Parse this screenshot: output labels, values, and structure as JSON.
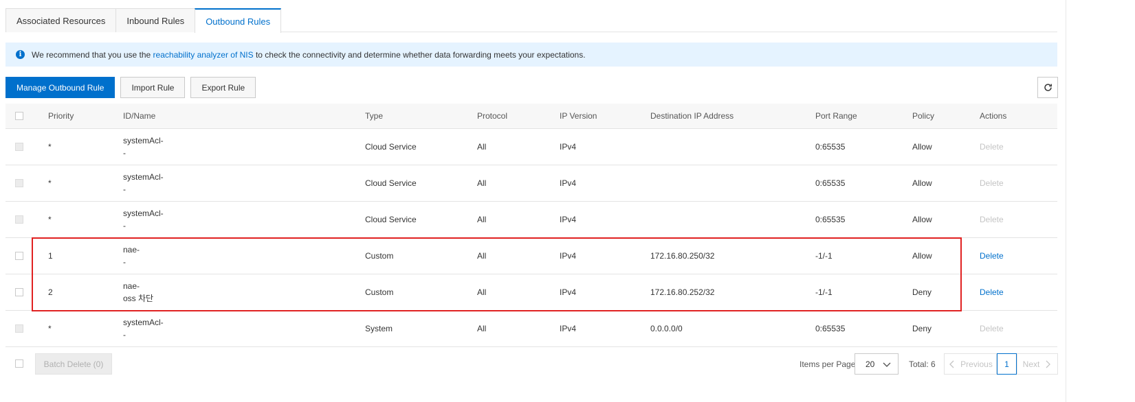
{
  "tabs": [
    {
      "label": "Associated Resources",
      "active": false
    },
    {
      "label": "Inbound Rules",
      "active": false
    },
    {
      "label": "Outbound Rules",
      "active": true
    }
  ],
  "banner": {
    "prefix": "We recommend that you use the ",
    "link": "reachability analyzer of NIS",
    "suffix": " to check the connectivity and determine whether data forwarding meets your expectations."
  },
  "toolbar": {
    "manage_label": "Manage Outbound Rule",
    "import_label": "Import Rule",
    "export_label": "Export Rule"
  },
  "table": {
    "headers": {
      "priority": "Priority",
      "name": "ID/Name",
      "type": "Type",
      "protocol": "Protocol",
      "ip_version": "IP Version",
      "destination": "Destination IP Address",
      "port_range": "Port Range",
      "policy": "Policy",
      "actions": "Actions"
    },
    "rows": [
      {
        "priority": "*",
        "id": "systemAcl-",
        "name": "-",
        "type": "Cloud Service",
        "protocol": "All",
        "ip_version": "IPv4",
        "destination": "",
        "port_range": "0:65535",
        "policy": "Allow",
        "action": "Delete"
      },
      {
        "priority": "*",
        "id": "systemAcl-",
        "name": "-",
        "type": "Cloud Service",
        "protocol": "All",
        "ip_version": "IPv4",
        "destination": "",
        "port_range": "0:65535",
        "policy": "Allow",
        "action": "Delete"
      },
      {
        "priority": "*",
        "id": "systemAcl-",
        "name": "-",
        "type": "Cloud Service",
        "protocol": "All",
        "ip_version": "IPv4",
        "destination": "",
        "port_range": "0:65535",
        "policy": "Allow",
        "action": "Delete"
      },
      {
        "priority": "1",
        "id": "nae-",
        "name": "-",
        "type": "Custom",
        "protocol": "All",
        "ip_version": "IPv4",
        "destination": "172.16.80.250/32",
        "port_range": "-1/-1",
        "policy": "Allow",
        "action": "Delete"
      },
      {
        "priority": "2",
        "id": "nae-",
        "name": "oss 차단",
        "type": "Custom",
        "protocol": "All",
        "ip_version": "IPv4",
        "destination": "172.16.80.252/32",
        "port_range": "-1/-1",
        "policy": "Deny",
        "action": "Delete"
      },
      {
        "priority": "*",
        "id": "systemAcl-",
        "name": "-",
        "type": "System",
        "protocol": "All",
        "ip_version": "IPv4",
        "destination": "0.0.0.0/0",
        "port_range": "0:65535",
        "policy": "Deny",
        "action": "Delete"
      }
    ]
  },
  "footer": {
    "batch_delete": "Batch Delete (0)",
    "items_per_page_label": "Items per Page",
    "items_per_page_value": "20",
    "total": "Total: 6",
    "previous": "Previous",
    "page": "1",
    "next": "Next"
  },
  "colors": {
    "accent": "#0070cc",
    "highlight": "#e02020",
    "banner_bg": "#e5f3ff"
  },
  "icons": {
    "info": "info-icon",
    "refresh": "refresh-icon",
    "chevron": "chevron-down-icon"
  }
}
